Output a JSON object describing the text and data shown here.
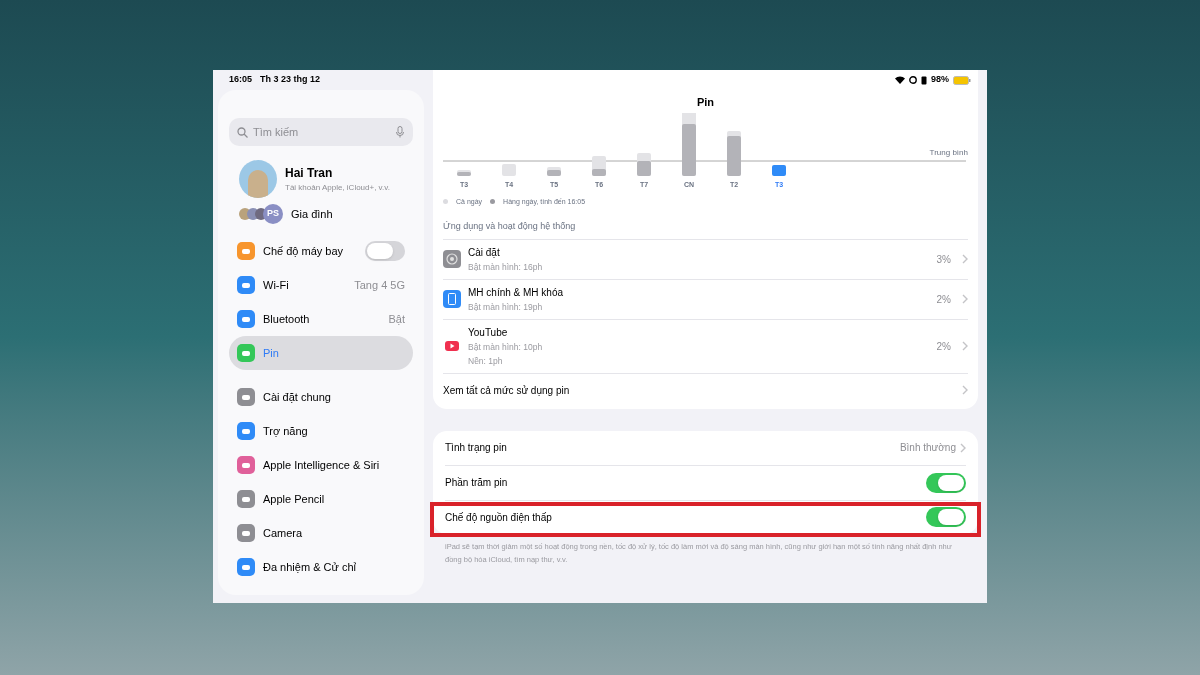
{
  "status_bar": {
    "time": "16:05",
    "date": "Th 3 23 thg 12",
    "battery": "98%"
  },
  "sidebar": {
    "search": {
      "placeholder": "Tìm kiếm"
    },
    "account": {
      "name": "Hai Tran",
      "subtitle": "Tài khoản Apple, iCloud+, v.v."
    },
    "family": {
      "label": "Gia đình",
      "badge": "PS"
    },
    "groups": [
      [
        {
          "kind": "toggle",
          "label": "Chế độ máy bay",
          "on": false,
          "color": "#f7952d",
          "selected": false
        },
        {
          "kind": "value",
          "label": "Wi-Fi",
          "value": "Tang 4 5G",
          "color": "#2f8bf7",
          "selected": false
        },
        {
          "kind": "value",
          "label": "Bluetooth",
          "value": "Bật",
          "color": "#2f8bf7",
          "selected": false
        },
        {
          "kind": "plain",
          "label": "Pin",
          "color": "#34c759",
          "selected": true
        }
      ],
      [
        {
          "kind": "plain",
          "label": "Cài đặt chung",
          "color": "#8e8e93",
          "selected": false
        },
        {
          "kind": "plain",
          "label": "Trợ năng",
          "color": "#2f8bf7",
          "selected": false
        },
        {
          "kind": "plain",
          "label": "Apple Intelligence & Siri",
          "color": "#e0609a",
          "selected": false
        },
        {
          "kind": "plain",
          "label": "Apple Pencil",
          "color": "#8e8e93",
          "selected": false
        },
        {
          "kind": "plain",
          "label": "Camera",
          "color": "#8e8e93",
          "selected": false
        },
        {
          "kind": "plain",
          "label": "Đa nhiệm & Cử chỉ",
          "color": "#2f8bf7",
          "selected": false
        }
      ]
    ]
  },
  "chart": {
    "title": "Pin",
    "average_label": "Trung bình",
    "days": [
      {
        "label": "T3",
        "selected": false
      },
      {
        "label": "T4",
        "selected": false
      },
      {
        "label": "T5",
        "selected": false
      },
      {
        "label": "T6",
        "selected": false
      },
      {
        "label": "T7",
        "selected": false
      },
      {
        "label": "CN",
        "selected": false
      },
      {
        "label": "T2",
        "selected": false
      },
      {
        "label": "T3",
        "selected": true
      }
    ],
    "legend": [
      "Cả ngày",
      "Hàng ngày, tính đến 16:05"
    ]
  },
  "apps": {
    "header": "Ứng dụng và hoạt động hệ thống",
    "rows": [
      {
        "kind": "settings",
        "name": "Cài đặt",
        "details": [
          "Bật màn hình: 16ph"
        ],
        "percent": "3%"
      },
      {
        "kind": "homescreen",
        "name": "MH chính & MH khóa",
        "details": [
          "Bật màn hình: 19ph"
        ],
        "percent": "2%"
      },
      {
        "kind": "youtube",
        "name": "YouTube",
        "details": [
          "Bật màn hình: 10ph",
          "Nền: 1ph"
        ],
        "percent": "2%"
      }
    ],
    "see_all": "Xem tất cả mức sử dụng pin"
  },
  "options": [
    {
      "kind": "value",
      "label": "Tình trạng pin",
      "value": "Bình thường",
      "highlighted": false
    },
    {
      "kind": "toggle",
      "label": "Phần trăm pin",
      "on": true,
      "highlighted": false
    },
    {
      "kind": "toggle",
      "label": "Chế độ nguồn điện thấp",
      "on": true,
      "highlighted": true
    }
  ],
  "footnote": "iPad sẽ tạm thời giảm một số hoạt động trong nền, tốc độ xử lý, tốc độ làm mới và độ sáng màn hình, cũng như giới hạn một số tính năng nhất định như đồng bộ hóa iCloud, tìm nạp thư, v.v."
}
